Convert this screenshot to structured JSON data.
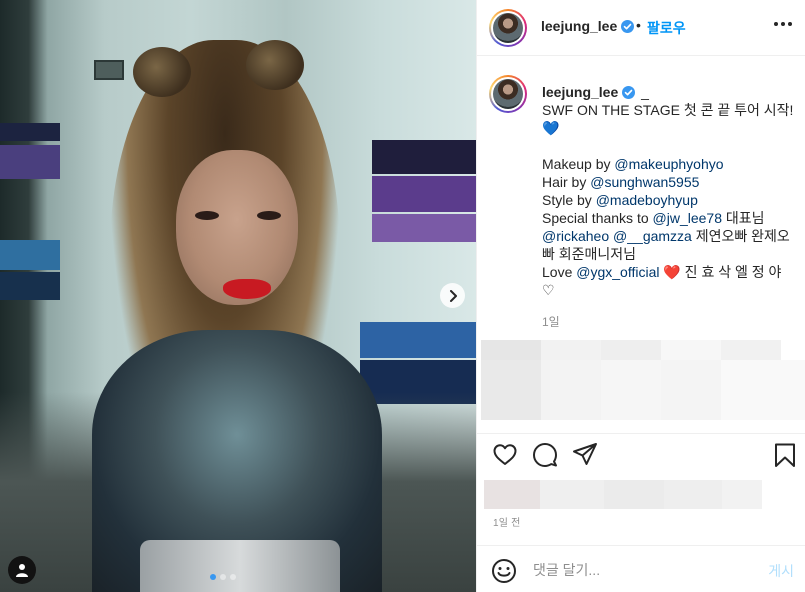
{
  "post": {
    "photo_alt": "",
    "slide_count": 3,
    "active_slide": 1
  },
  "header": {
    "username": "leejung_lee",
    "separator": "•",
    "follow_label": "팔로우",
    "more_icon": "more-horizontal-icon"
  },
  "caption": {
    "username": "leejung_lee",
    "first_line_suffix": "_",
    "line1": "SWF ON THE STAGE 첫 콘 끝 투어 시작!",
    "heart_emoji": "💙",
    "makeup_prefix": "Makeup by ",
    "makeup_mention": "@makeuphyohyo",
    "hair_prefix": "Hair by ",
    "hair_mention": "@sunghwan5955",
    "style_prefix": "Style by ",
    "style_mention": "@madeboyhyup",
    "thanks_prefix": "Special thanks to ",
    "thanks_mention": "@jw_lee78",
    "thanks_suffix": " 대표님",
    "mention_rickaheo": "@rickaheo",
    "mention_gamzza": "@__gamzza",
    "line_staff_suffix": " 제연오빠 완제오",
    "line_staff_2": "빠 회준매니저님",
    "love_prefix": "Love ",
    "love_mention": "@ygx_official",
    "love_heart": "❤️",
    "love_suffix": " 진 효 삭 엘 정 야",
    "last_heart": "♡",
    "time_ago": "1일"
  },
  "footer": {
    "date": "1일 전",
    "comment_placeholder": "댓글 달기...",
    "post_label": "게시"
  },
  "colors": {
    "accent": "#0095f6",
    "post_disabled": "#b2dffc",
    "mention": "#00376b",
    "verified": "#3897f0"
  }
}
